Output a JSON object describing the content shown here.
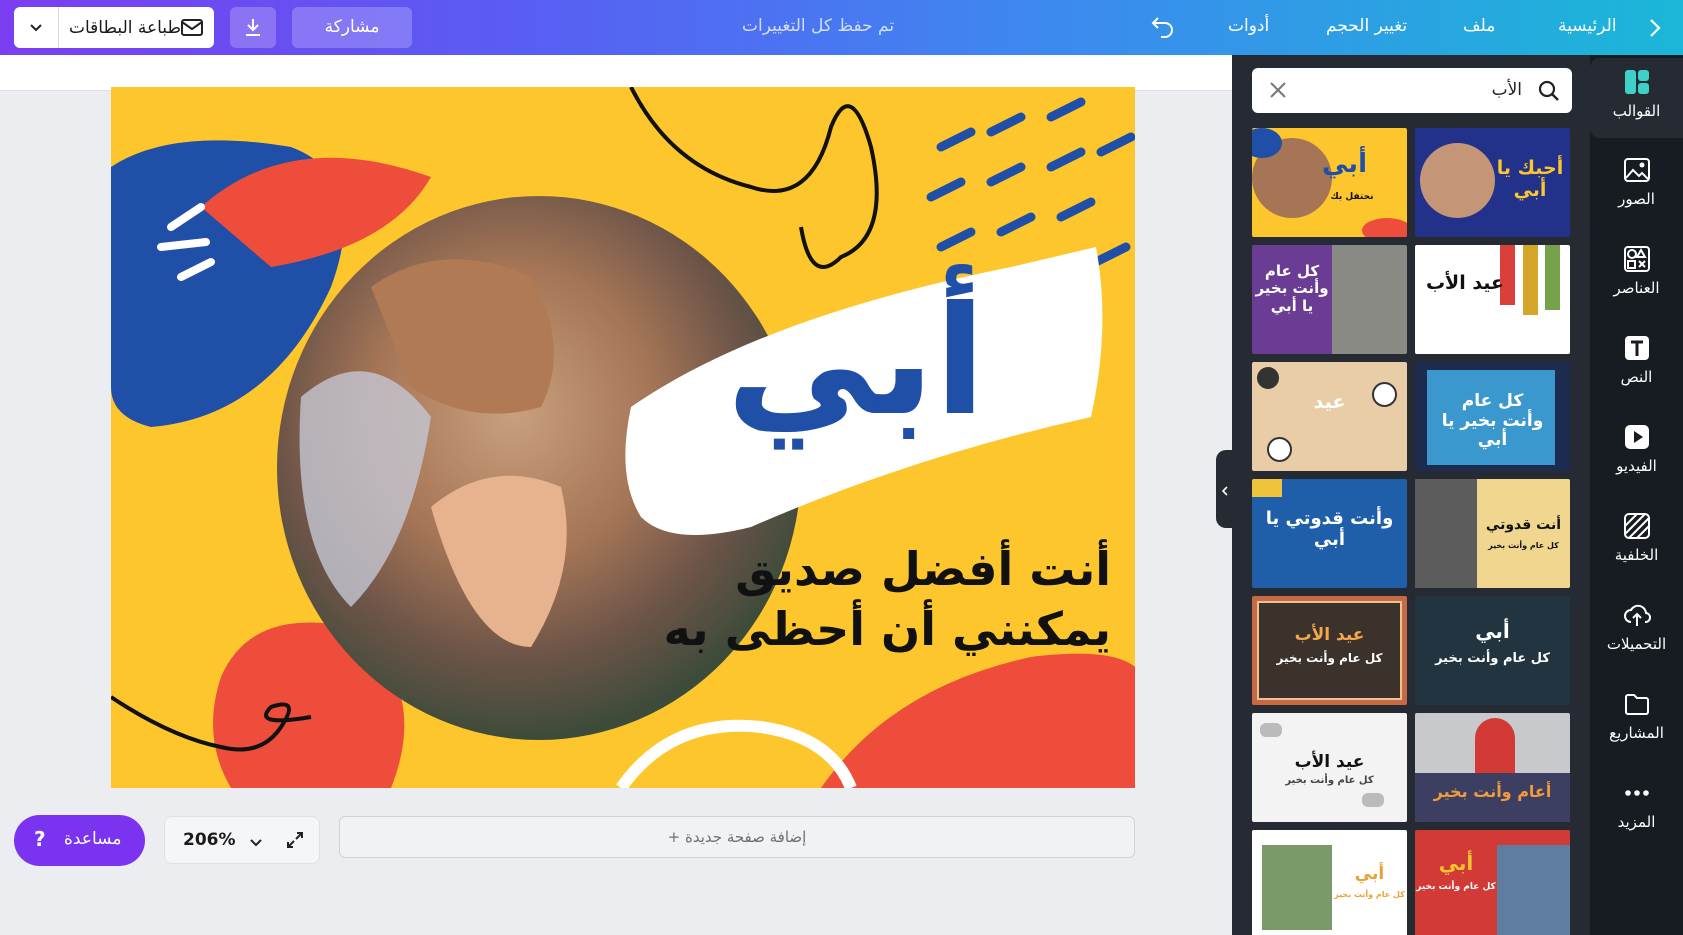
{
  "topbar": {
    "home": "الرئيسية",
    "file": "ملف",
    "resize": "تغيير الحجم",
    "tools": "أدوات",
    "saved_status": "تم حفظ كل التغييرات",
    "share": "مشاركة",
    "print_cards": "طباعة البطاقات"
  },
  "editor": {
    "add_page": "إضافة صفحة جديدة",
    "zoom": "206%",
    "help": "مساعدة"
  },
  "design": {
    "title": "أبي",
    "line1": "أنت أفضل صديق",
    "line2": "يمكنني أن أحظى به"
  },
  "search": {
    "query": "الأب"
  },
  "templates": [
    {
      "label": "أبي",
      "sub": "نحتفل بك"
    },
    {
      "label": "أحبك يا أبي"
    },
    {
      "label": "كل عام وأنت بخير يا أبي"
    },
    {
      "label": "عيد الأب"
    },
    {
      "label": "عيد"
    },
    {
      "label": "كل عام وأنت بخير يا أبي"
    },
    {
      "label": "وأنت قدوتي يا أبي"
    },
    {
      "label": "أنت قدوتي",
      "sub": "كل عام وأنت بخير"
    },
    {
      "label": "عيد الأب",
      "sub": "كل عام وأنت بخير"
    },
    {
      "label": "أبي",
      "sub": "كل عام وأنت بخير"
    },
    {
      "label": "عيد الأب",
      "sub": "كل عام وأنت بخير"
    },
    {
      "label": "أعام وأنت بخير"
    },
    {
      "label": "أبي",
      "sub": "كل عام وأنت بخير"
    },
    {
      "label": "أبي",
      "sub": "كل عام وأنت بخير"
    }
  ],
  "sidebar": {
    "items": [
      {
        "label": "القوالب",
        "icon": "templates-icon"
      },
      {
        "label": "الصور",
        "icon": "photos-icon"
      },
      {
        "label": "العناصر",
        "icon": "elements-icon"
      },
      {
        "label": "النص",
        "icon": "text-icon"
      },
      {
        "label": "الفيديو",
        "icon": "video-icon"
      },
      {
        "label": "الخلفية",
        "icon": "background-icon"
      },
      {
        "label": "التحميلات",
        "icon": "uploads-icon"
      },
      {
        "label": "المشاريع",
        "icon": "projects-icon"
      },
      {
        "label": "المزيد",
        "icon": "more-icon"
      }
    ]
  }
}
